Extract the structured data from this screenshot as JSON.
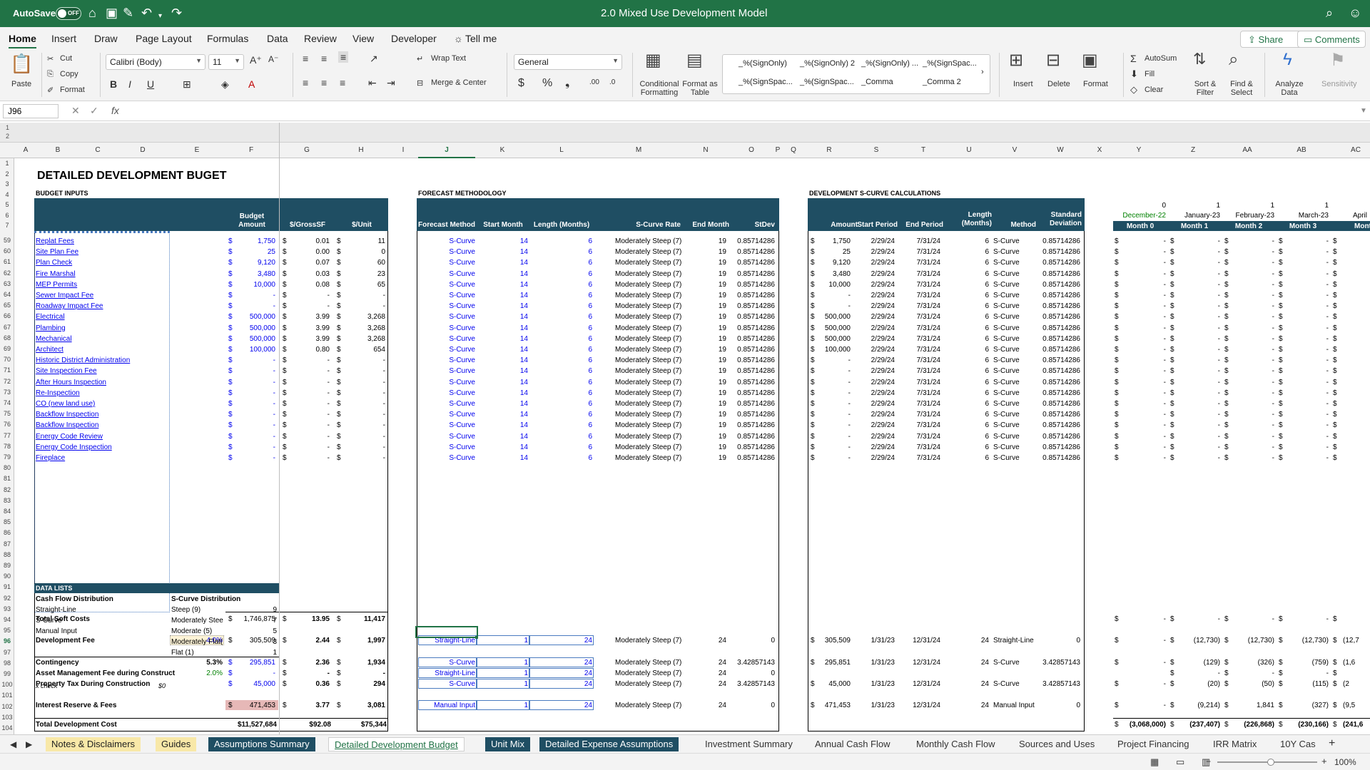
{
  "titlebar": {
    "autosave": "AutoSave",
    "autosave_state": "OFF",
    "doc_title": "2.0 Mixed Use Development Model"
  },
  "ribbon_tabs": [
    "Home",
    "Insert",
    "Draw",
    "Page Layout",
    "Formulas",
    "Data",
    "Review",
    "View",
    "Developer",
    "Tell me"
  ],
  "share": "Share",
  "comments": "Comments",
  "ribbon": {
    "paste": "Paste",
    "cut": "Cut",
    "copy": "Copy",
    "format": "Format",
    "font_name": "Calibri (Body)",
    "font_size": "11",
    "wrap_text": "Wrap Text",
    "merge_center": "Merge & Center",
    "number_format": "General",
    "conditional_formatting": "Conditional Formatting",
    "format_as_table": "Format as Table",
    "styles": [
      "_%(SignOnly)",
      "_%(SignOnly) 2",
      "_%(SignOnly) ...",
      "_%(SignSpac...",
      "_%(SignSpac...",
      "_%(SignSpac...",
      "_Comma",
      "_Comma 2"
    ],
    "insert": "Insert",
    "delete": "Delete",
    "format_cells": "Format",
    "autosum": "AutoSum",
    "fill": "Fill",
    "clear": "Clear",
    "sort_filter": "Sort & Filter",
    "find_select": "Find & Select",
    "analyze_data": "Analyze Data",
    "sensitivity": "Sensitivity"
  },
  "formula_bar": {
    "name_box": "J96",
    "fx": "fx"
  },
  "columns": [
    "A",
    "B",
    "C",
    "D",
    "E",
    "F",
    "G",
    "H",
    "I",
    "J",
    "K",
    "L",
    "M",
    "N",
    "O",
    "P",
    "Q",
    "R",
    "S",
    "T",
    "U",
    "V",
    "W",
    "X",
    "Y",
    "Z",
    "AA",
    "AB",
    "AC"
  ],
  "outline_levels": [
    "1",
    "2"
  ],
  "sheet": {
    "title": "DETAILED DEVELOPMENT BUGET",
    "budget_inputs": "BUDGET INPUTS",
    "forecast_methodology": "FORECAST METHODOLOGY",
    "scurve_calcs": "DEVELOPMENT S-CURVE CALCULATIONS",
    "budget_headers": [
      "Budget Amount",
      "$/GrossSF",
      "$/Unit"
    ],
    "forecast_headers": [
      "Forecast Method",
      "Start Month",
      "Length (Months)",
      "S-Curve Rate",
      "End Month",
      "StDev"
    ],
    "scurve_headers": [
      "Amount",
      "Start Period",
      "End Period",
      "Length (Months)",
      "Method",
      "Standard Deviation"
    ],
    "months_top": [
      "0",
      "1",
      "1",
      "1"
    ],
    "month_names": [
      "December-22",
      "January-23",
      "February-23",
      "March-23",
      "April"
    ],
    "month_headers": [
      "Month 0",
      "Month 1",
      "Month 2",
      "Month 3",
      "Month 4"
    ],
    "line_items": [
      {
        "row": "59",
        "name": "Replat Fees",
        "amt": "1,750",
        "gsf": "0.01",
        "unit": "11",
        "s_amt": "1,750"
      },
      {
        "row": "60",
        "name": "Site Plan Fee",
        "amt": "25",
        "gsf": "0.00",
        "unit": "0",
        "s_amt": "25"
      },
      {
        "row": "61",
        "name": "Plan Check",
        "amt": "9,120",
        "gsf": "0.07",
        "unit": "60",
        "s_amt": "9,120"
      },
      {
        "row": "62",
        "name": "Fire Marshal",
        "amt": "3,480",
        "gsf": "0.03",
        "unit": "23",
        "s_amt": "3,480"
      },
      {
        "row": "63",
        "name": "MEP Permits",
        "amt": "10,000",
        "gsf": "0.08",
        "unit": "65",
        "s_amt": "10,000"
      },
      {
        "row": "64",
        "name": "Sewer Impact Fee",
        "amt": "-",
        "gsf": "-",
        "unit": "-",
        "s_amt": "-"
      },
      {
        "row": "65",
        "name": "Roadway Impact Fee",
        "amt": "-",
        "gsf": "-",
        "unit": "-",
        "s_amt": "-"
      },
      {
        "row": "66",
        "name": "Electrical",
        "amt": "500,000",
        "gsf": "3.99",
        "unit": "3,268",
        "s_amt": "500,000"
      },
      {
        "row": "67",
        "name": "Plambing",
        "amt": "500,000",
        "gsf": "3.99",
        "unit": "3,268",
        "s_amt": "500,000"
      },
      {
        "row": "68",
        "name": "Mechanical",
        "amt": "500,000",
        "gsf": "3.99",
        "unit": "3,268",
        "s_amt": "500,000"
      },
      {
        "row": "69",
        "name": "Architect",
        "amt": "100,000",
        "gsf": "0.80",
        "unit": "654",
        "s_amt": "100,000"
      },
      {
        "row": "70",
        "name": "Historic District Administration",
        "amt": "-",
        "gsf": "-",
        "unit": "-",
        "s_amt": "-"
      },
      {
        "row": "71",
        "name": "Site Inspection Fee",
        "amt": "-",
        "gsf": "-",
        "unit": "-",
        "s_amt": "-"
      },
      {
        "row": "72",
        "name": "After Hours Inspection",
        "amt": "-",
        "gsf": "-",
        "unit": "-",
        "s_amt": "-"
      },
      {
        "row": "73",
        "name": "Re-Inspection",
        "amt": "-",
        "gsf": "-",
        "unit": "-",
        "s_amt": "-"
      },
      {
        "row": "74",
        "name": "CO (new land use)",
        "amt": "-",
        "gsf": "-",
        "unit": "-",
        "s_amt": "-"
      },
      {
        "row": "75",
        "name": "Backflow Inspection",
        "amt": "-",
        "gsf": "-",
        "unit": "-",
        "s_amt": "-"
      },
      {
        "row": "76",
        "name": "Backflow Inspection",
        "amt": "-",
        "gsf": "-",
        "unit": "-",
        "s_amt": "-"
      },
      {
        "row": "77",
        "name": "Energy Code Review",
        "amt": "-",
        "gsf": "-",
        "unit": "-",
        "s_amt": "-"
      },
      {
        "row": "78",
        "name": "Energy Code Inspection",
        "amt": "-",
        "gsf": "-",
        "unit": "-",
        "s_amt": "-"
      },
      {
        "row": "79",
        "name": "Fireplace",
        "amt": "-",
        "gsf": "-",
        "unit": "-",
        "s_amt": "-"
      }
    ],
    "item_forecast": {
      "method": "S-Curve",
      "start": "14",
      "length": "6",
      "rate": "Moderately Steep (7)",
      "end": "19",
      "stdev": "0.85714286",
      "s_start": "2/29/24",
      "s_end": "7/31/24",
      "s_len": "6",
      "s_method": "S-Curve",
      "s_std": "0.85714286"
    },
    "dollar": "$",
    "dash": "-",
    "total_soft": {
      "label": "Total Soft Costs",
      "amt": "1,746,875",
      "gsf": "13.95",
      "unit": "11,417"
    },
    "dev_fee": {
      "label": "Development Fee",
      "pct": "4.0%",
      "amt": "305,509",
      "gsf": "2.44",
      "unit": "1,997",
      "method": "Straight-Line",
      "start": "1",
      "length": "24",
      "rate": "Moderately Steep (7)",
      "end": "24",
      "stdev": "0",
      "s_amt": "305,509",
      "s_start": "1/31/23",
      "s_end": "12/31/24",
      "s_len": "24",
      "s_method": "Straight-Line",
      "s_std": "0",
      "m0": "-",
      "m1": "(12,730)",
      "m2": "(12,730)",
      "m3": "(12,730)",
      "m4": "(12,7"
    },
    "contingency": {
      "label": "Contingency",
      "pct": "5.3%",
      "amt": "295,851",
      "gsf": "2.36",
      "unit": "1,934",
      "method": "S-Curve",
      "start": "1",
      "length": "24",
      "rate": "Moderately Steep (7)",
      "end": "24",
      "stdev": "3.42857143",
      "s_amt": "295,851",
      "s_start": "1/31/23",
      "s_end": "12/31/24",
      "s_len": "24",
      "s_method": "S-Curve",
      "s_std": "3.42857143",
      "m0": "-",
      "m1": "(129)",
      "m2": "(326)",
      "m3": "(759)",
      "m4": "(1,6"
    },
    "asset_mgmt": {
      "label": "Asset Management Fee during Construct",
      "pct": "2.0%",
      "amt": "-",
      "gsf": "-",
      "unit": "-",
      "method": "Straight-Line",
      "start": "1",
      "length": "24",
      "rate": "Moderately Steep (7)",
      "end": "24",
      "stdev": "0"
    },
    "property_tax": {
      "label": "Property Tax During Construction",
      "amt": "45,000",
      "gsf": "0.36",
      "unit": "294",
      "method": "S-Curve",
      "start": "1",
      "length": "24",
      "rate": "Moderately Steep (7)",
      "end": "24",
      "stdev": "3.42857143",
      "s_amt": "45,000",
      "s_start": "1/31/23",
      "s_end": "12/31/24",
      "s_len": "24",
      "s_method": "S-Curve",
      "s_std": "3.42857143",
      "m0": "-",
      "m1": "(20)",
      "m2": "(50)",
      "m3": "(115)",
      "m4": "(2"
    },
    "interest": {
      "label": "Interest Reserve & Fees",
      "amt": "471,453",
      "gsf": "3.77",
      "unit": "3,081",
      "method": "Manual Input",
      "start": "1",
      "length": "24",
      "rate": "Moderately Steep (7)",
      "end": "24",
      "stdev": "0",
      "s_amt": "471,453",
      "s_start": "1/31/23",
      "s_end": "12/31/24",
      "s_len": "24",
      "s_method": "Manual Input",
      "s_std": "0",
      "m0": "-",
      "m1": "(9,214)",
      "m2": "1,841",
      "m3": "(327)",
      "m4": "(9,5"
    },
    "total_dev": {
      "label": "Total Development Cost",
      "amt": "$11,527,684",
      "gsf": "$92.08",
      "unit": "$75,344",
      "m0": "(3,068,000)",
      "m1": "(237,407)",
      "m2": "(226,868)",
      "m3": "(230,166)",
      "m4": "(241,6"
    },
    "data_lists": {
      "title": "DATA LISTS",
      "cf_header": "Cash Flow Distribution",
      "cf_items": [
        "Straight-Line",
        "S-Curve",
        "Manual Input"
      ],
      "sc_header": "S-Curve Distribution",
      "sc_items": [
        "Steep (9)",
        "Moderately Stee",
        "Moderate (5)",
        "Moderately Flat(",
        "Flat (1)"
      ],
      "sc_values": [
        "9",
        "7",
        "5",
        "3",
        "1"
      ]
    },
    "xcheck_label": "x check",
    "xcheck_value": "$0",
    "rows_extra": [
      "1",
      "2",
      "3",
      "4",
      "5",
      "6",
      "7",
      "80",
      "81",
      "82",
      "83",
      "84",
      "85",
      "86",
      "87",
      "88",
      "89",
      "90",
      "91",
      "92",
      "93",
      "94",
      "95",
      "96",
      "97",
      "98",
      "99",
      "100",
      "101",
      "102",
      "103",
      "104",
      "105"
    ]
  },
  "sheet_tabs": [
    "Notes & Disclaimers",
    "Guides",
    "Assumptions Summary",
    "Detailed Development Budget",
    "Unit Mix",
    "Detailed Expense Assumptions",
    "Investment Summary",
    "Annual Cash Flow",
    "Monthly Cash Flow",
    "Sources and Uses",
    "Project Financing",
    "IRR Matrix",
    "10Y Cas"
  ],
  "status": {
    "zoom": "100%"
  },
  "colors": {
    "excel_green": "#217346",
    "header_navy": "#1f4e63",
    "input_blue": "#0000ee"
  }
}
